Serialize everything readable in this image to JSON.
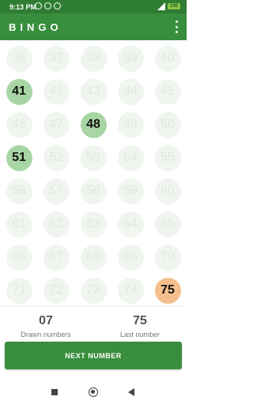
{
  "status_bar": {
    "time": "9:13 PM",
    "battery": "100"
  },
  "app_bar": {
    "title": "BINGO"
  },
  "numbers": {
    "visible": [
      36,
      37,
      38,
      39,
      40,
      41,
      42,
      43,
      44,
      45,
      46,
      47,
      48,
      49,
      50,
      51,
      52,
      53,
      54,
      55,
      56,
      57,
      58,
      59,
      60,
      61,
      62,
      63,
      64,
      65,
      66,
      67,
      68,
      69,
      70,
      71,
      72,
      73,
      74,
      75
    ],
    "drawn": [
      41,
      48,
      51
    ],
    "last_drawn": 75
  },
  "stats": {
    "drawn_count": "07",
    "drawn_label": "Drawn numbers",
    "last_number": "75",
    "last_label": "Last number"
  },
  "actions": {
    "next_label": "NEXT NUMBER"
  },
  "colors": {
    "primary": "#388e3c",
    "drawn": "#a8d5a4",
    "last": "#f5c08d"
  }
}
